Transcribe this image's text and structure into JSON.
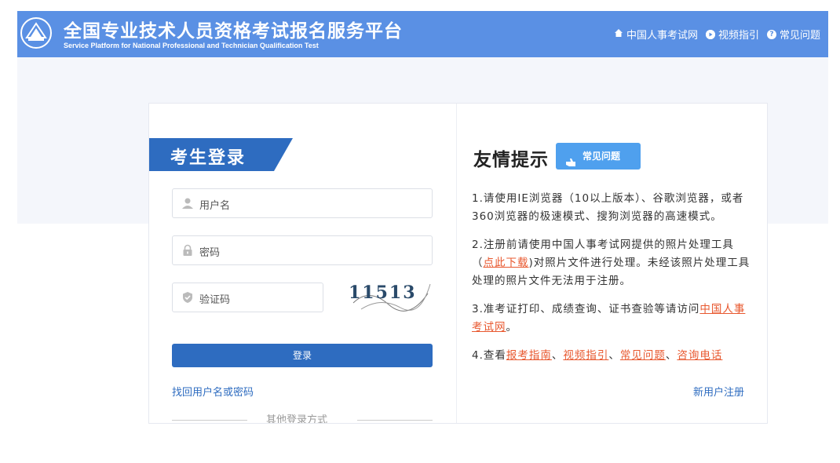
{
  "header": {
    "title": "全国专业技术人员资格考试报名服务平台",
    "subtitle": "Service Platform for National Professional and Technician Qualification Test",
    "nav": [
      {
        "label": "中国人事考试网",
        "icon": "home-icon"
      },
      {
        "label": "视频指引",
        "icon": "play-icon"
      },
      {
        "label": "常见问题",
        "icon": "question-icon"
      }
    ],
    "color": "#5a90e4"
  },
  "login": {
    "tab_label": "考生登录",
    "username_placeholder": "用户名",
    "password_placeholder": "密码",
    "captcha_placeholder": "验证码",
    "captcha_text": "11513",
    "submit_label": "登录",
    "forgot_link": "找回用户名或密码",
    "register_link": "新用户注册",
    "other_methods": "其他登录方式",
    "accent": "#2e6cc0"
  },
  "tips": {
    "title": "友情提示",
    "faq_badge": "常见问题",
    "item1": "1.请使用IE浏览器（10以上版本）、谷歌浏览器，或者360浏览器的极速模式、搜狗浏览器的高速模式。",
    "item2_pre": "2.注册前请使用中国人事考试网提供的照片处理工具（",
    "item2_link": "点此下载",
    "item2_post": ")对照片文件进行处理。未经该照片处理工具处理的照片文件无法用于注册。",
    "item3_pre": "3.准考证打印、成绩查询、证书查验等请访问",
    "item3_link": "中国人事考试网",
    "item3_post": "。",
    "item4_pre": "4.查看",
    "item4_links": [
      "报考指南",
      "视频指引",
      "常见问题",
      "咨询电话"
    ],
    "item4_sep": "、",
    "link_color": "#e8582f"
  }
}
